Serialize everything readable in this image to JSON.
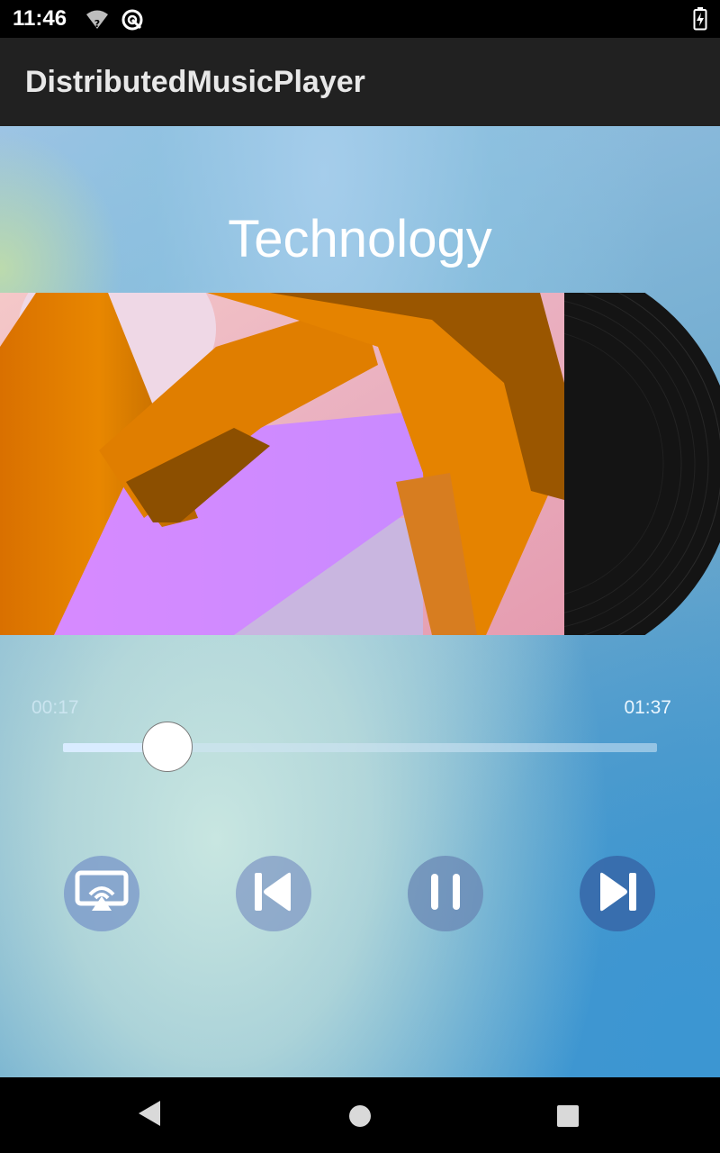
{
  "status_bar": {
    "time": "11:46",
    "icons": [
      "wifi-question-icon",
      "data-saver-icon",
      "battery-charging-icon"
    ]
  },
  "app_bar": {
    "title": "DistributedMusicPlayer"
  },
  "player": {
    "song_title": "Technology",
    "time_current": "00:17",
    "time_total": "01:37",
    "progress_fraction": 0.175
  },
  "controls": [
    {
      "name": "cast-button",
      "icon": "cast-screen-icon"
    },
    {
      "name": "previous-button",
      "icon": "skip-previous-icon"
    },
    {
      "name": "pause-button",
      "icon": "pause-icon"
    },
    {
      "name": "next-button",
      "icon": "skip-next-icon"
    }
  ],
  "navigation": {
    "icons": [
      "back-triangle-icon",
      "home-circle-icon",
      "recents-square-icon"
    ]
  },
  "colors": {
    "app_bar": "#212121",
    "seek_fill": "#d9ecff",
    "button_bg": "#8aa5c8"
  }
}
